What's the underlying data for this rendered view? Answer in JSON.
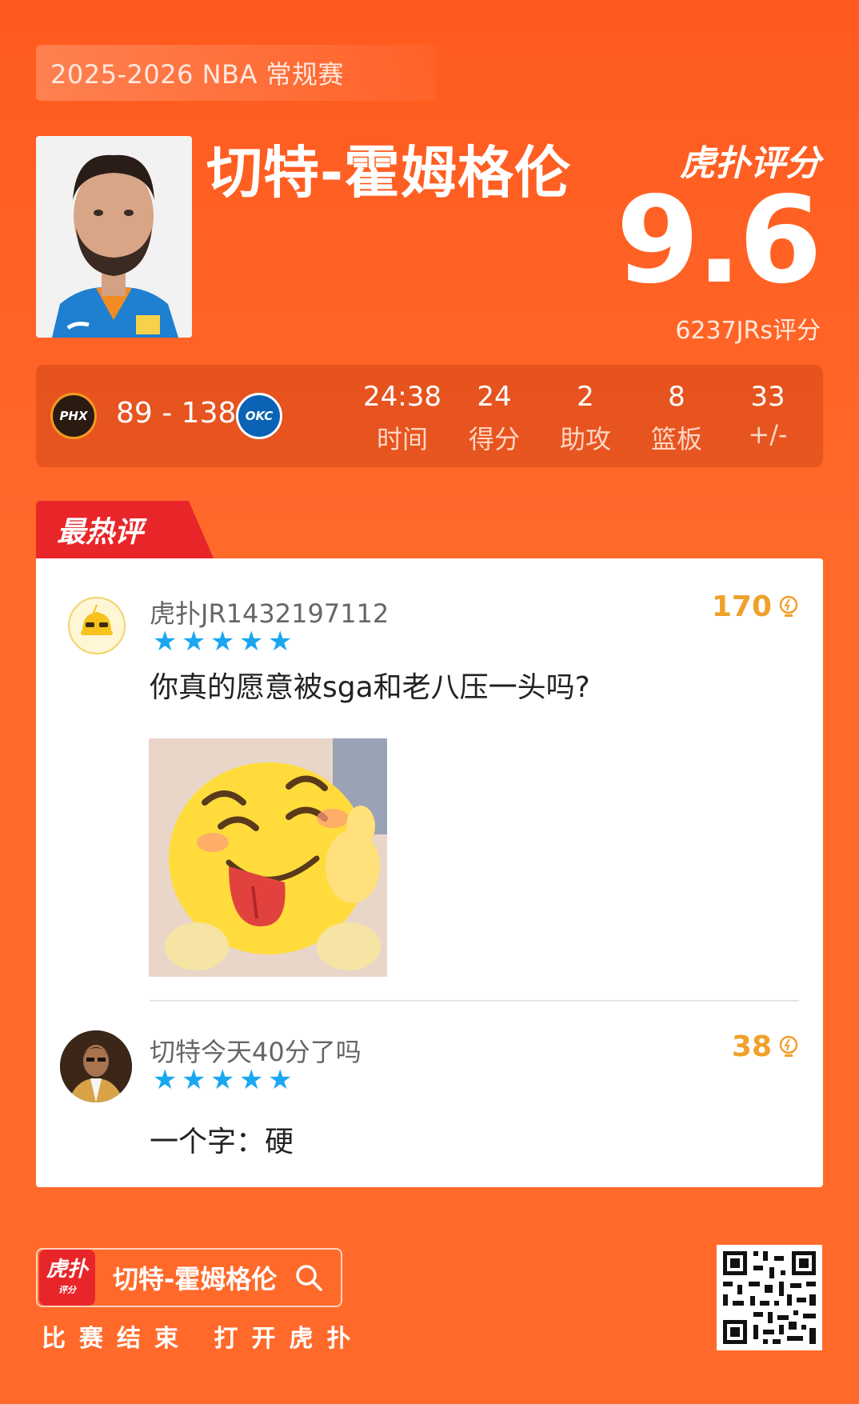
{
  "header": {
    "season": "2025-2026 NBA 常规赛",
    "player_name": "切特-霍姆格伦",
    "rating_brand": "虎扑评分",
    "rating_score": "9.6",
    "rating_count": "6237JRs评分"
  },
  "game": {
    "home_abbr": "PHX",
    "away_abbr": "OKC",
    "score": "89 - 138",
    "stats": [
      {
        "value": "24:38",
        "label": "时间"
      },
      {
        "value": "24",
        "label": "得分"
      },
      {
        "value": "2",
        "label": "助攻"
      },
      {
        "value": "8",
        "label": "篮板"
      },
      {
        "value": "33",
        "label": "+/-"
      }
    ]
  },
  "comments_tab": {
    "label": "最热评"
  },
  "comments": [
    {
      "user": "虎扑JR1432197112",
      "stars": 5,
      "likes": "170",
      "text": "你真的愿意被sga和老八压一头吗?"
    },
    {
      "user": "切特今天40分了吗",
      "stars": 5,
      "likes": "38",
      "text": "一个字：硬"
    }
  ],
  "footer": {
    "app_icon_text": "虎扑",
    "app_icon_sub": "评分",
    "search_text": "切特-霍姆格伦",
    "cta": "比赛结束 打开虎扑"
  },
  "colors": {
    "background": "#ff6a2b",
    "accent_red": "#e8262a",
    "star_blue": "#1aa7f0",
    "like_gold": "#f0a12a"
  },
  "icons": [
    "search-icon",
    "bulb-icon",
    "star-icon",
    "qr-code-icon"
  ]
}
